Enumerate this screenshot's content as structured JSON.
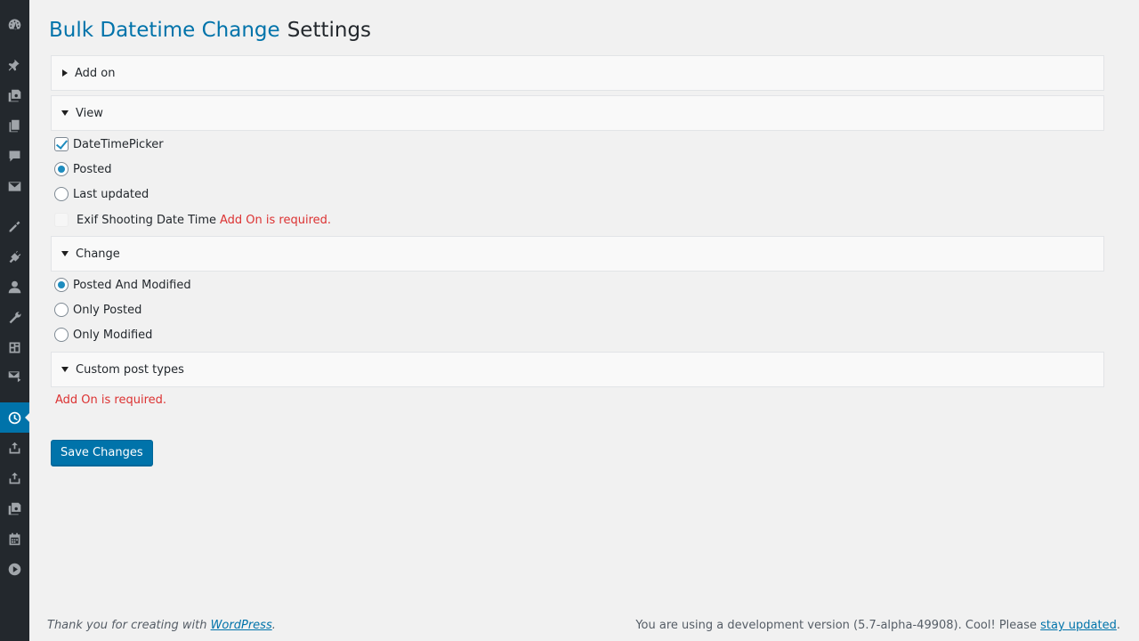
{
  "sidebar": {
    "icons": [
      "dashboard-icon",
      "pin-icon",
      "media-icon",
      "pages-icon",
      "comments-icon",
      "mail-icon",
      "appearance-icon",
      "plugins-icon",
      "users-icon",
      "tools-icon",
      "settings-icon",
      "mail-settings-icon",
      "clock-icon",
      "upload-icon",
      "upload-icon-2",
      "media-icon-2",
      "calendar-icon",
      "play-icon"
    ],
    "active": "clock-icon"
  },
  "page": {
    "plugin_name": "Bulk Datetime Change",
    "settings_label": "Settings"
  },
  "sections": {
    "addon": {
      "label": "Add on",
      "expanded": false
    },
    "view": {
      "label": "View",
      "expanded": true,
      "datetimepicker_label": "DateTimePicker",
      "datetimepicker_checked": true,
      "posted_label": "Posted",
      "last_updated_label": "Last updated",
      "selected": "Posted",
      "exif_label": "Exif Shooting Date Time",
      "exif_required": "Add On is required."
    },
    "change": {
      "label": "Change",
      "expanded": true,
      "options": [
        "Posted And Modified",
        "Only Posted",
        "Only Modified"
      ],
      "selected": "Posted And Modified"
    },
    "custom": {
      "label": "Custom post types",
      "expanded": true,
      "required": "Add On is required."
    }
  },
  "save_button": "Save Changes",
  "footer": {
    "left_text": "Thank you for creating with ",
    "left_link": "WordPress",
    "left_end": ".",
    "right_text": "You are using a development version (5.7-alpha-49908). Cool! Please ",
    "right_link": "stay updated",
    "right_end": "."
  },
  "colors": {
    "accent": "#0073aa",
    "error": "#dc3232",
    "sidebar": "#23282d"
  }
}
